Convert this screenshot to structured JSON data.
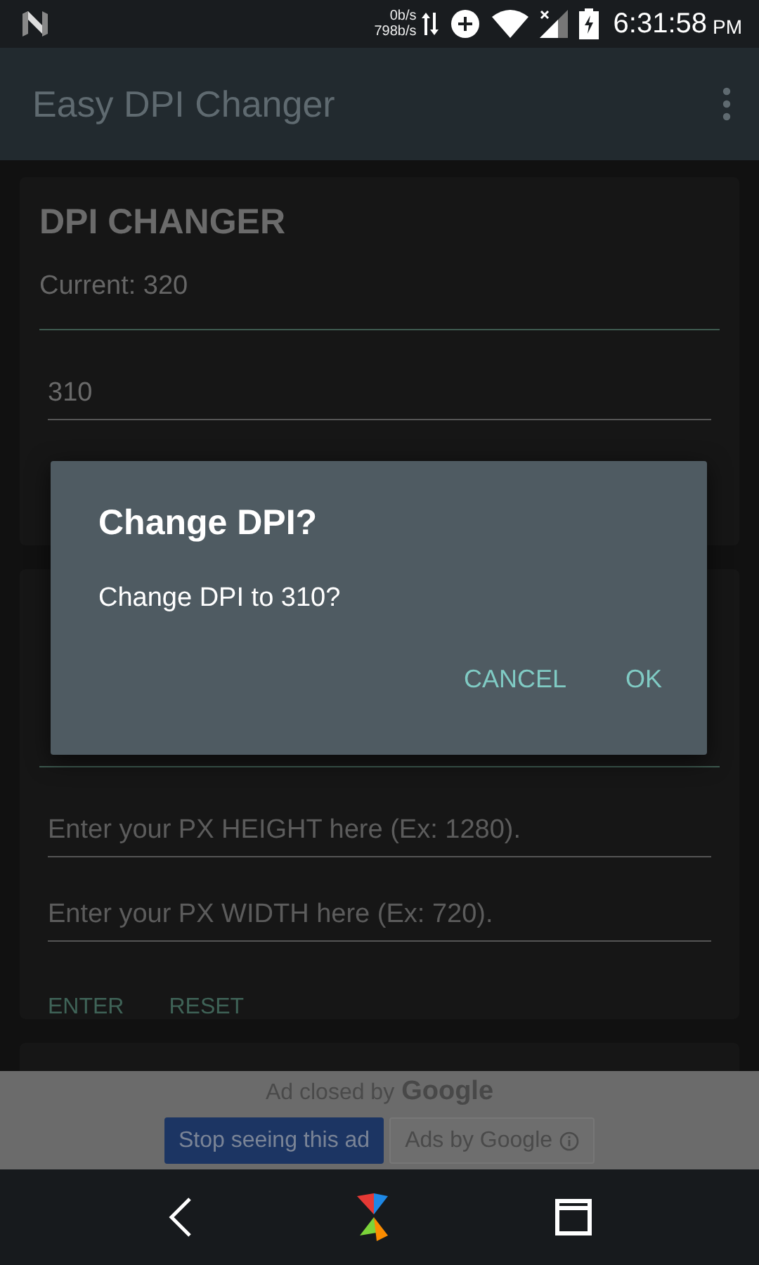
{
  "status_bar": {
    "speed_up": "0b/s",
    "speed_down": "798b/s",
    "time": "6:31:58",
    "ampm": "PM"
  },
  "app_bar": {
    "title": "Easy DPI Changer"
  },
  "dpi_card": {
    "title": "DPI CHANGER",
    "current": "Current: 320",
    "input": {
      "value": "310"
    }
  },
  "second_card": {
    "fields": [
      {
        "placeholder": "Enter your PX HEIGHT here (Ex: 1280)."
      },
      {
        "placeholder": "Enter your PX WIDTH here (Ex: 720)."
      }
    ],
    "buttons": [
      "ENTER",
      "RESET"
    ]
  },
  "dialog": {
    "title": "Change DPI?",
    "message": "Change DPI to 310?",
    "buttons": [
      "CANCEL",
      "OK"
    ]
  },
  "ad": {
    "notice": "Ad closed by",
    "brand": "Google",
    "buttons": [
      {
        "label": "Stop seeing this ad",
        "kind": "primary"
      },
      {
        "label": "Ads by Google",
        "kind": "info"
      }
    ]
  }
}
